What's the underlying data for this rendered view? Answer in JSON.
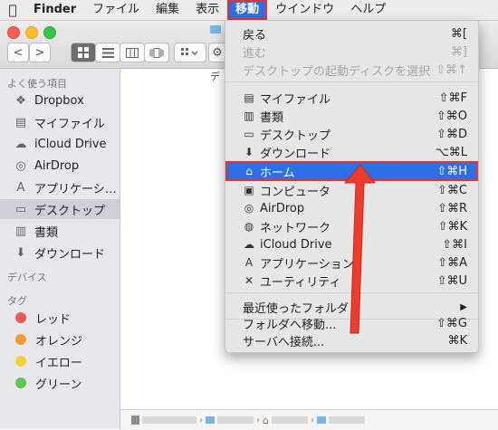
{
  "menubar": {
    "apple_icon": "apple-icon",
    "items": [
      {
        "label": "Finder"
      },
      {
        "label": "ファイル"
      },
      {
        "label": "編集"
      },
      {
        "label": "表示"
      },
      {
        "label": "移動"
      },
      {
        "label": "ウインドウ"
      },
      {
        "label": "ヘルプ"
      }
    ]
  },
  "toolbar": {
    "back": "<",
    "forward": ">",
    "caption": "デ"
  },
  "sidebar": {
    "favorites_header": "よく使う項目",
    "items": [
      {
        "label": "Dropbox",
        "icon": "dropbox-icon"
      },
      {
        "label": "マイファイル",
        "icon": "files-icon"
      },
      {
        "label": "iCloud Drive",
        "icon": "cloud-icon"
      },
      {
        "label": "AirDrop",
        "icon": "airdrop-icon"
      },
      {
        "label": "アプリケーシ…",
        "icon": "applications-icon"
      },
      {
        "label": "デスクトップ",
        "icon": "desktop-icon"
      },
      {
        "label": "書類",
        "icon": "documents-icon"
      },
      {
        "label": "ダウンロード",
        "icon": "download-icon"
      }
    ],
    "devices_header": "デバイス",
    "tags_header": "タグ",
    "tags": [
      {
        "label": "レッド",
        "color": "#f2574e"
      },
      {
        "label": "オレンジ",
        "color": "#f69c33"
      },
      {
        "label": "イエロー",
        "color": "#f5cf33"
      },
      {
        "label": "グリーン",
        "color": "#5cc74f"
      }
    ]
  },
  "go_menu": {
    "items": [
      {
        "label": "戻る",
        "shortcut": "⌘[",
        "enabled": true
      },
      {
        "label": "進む",
        "shortcut": "⌘]",
        "enabled": false
      },
      {
        "label": "デスクトップの起動ディスクを選択",
        "shortcut": "⇧⌘↑",
        "enabled": false
      },
      {
        "label": "マイファイル",
        "shortcut": "⇧⌘F",
        "icon": "files-icon"
      },
      {
        "label": "書類",
        "shortcut": "⇧⌘O",
        "icon": "documents-icon"
      },
      {
        "label": "デスクトップ",
        "shortcut": "⇧⌘D",
        "icon": "desktop-icon"
      },
      {
        "label": "ダウンロード",
        "shortcut": "⌥⌘L",
        "icon": "download-icon"
      },
      {
        "label": "ホーム",
        "shortcut": "⇧⌘H",
        "icon": "home-icon",
        "highlighted": true
      },
      {
        "label": "コンピュータ",
        "shortcut": "⇧⌘C",
        "icon": "computer-icon"
      },
      {
        "label": "AirDrop",
        "shortcut": "⇧⌘R",
        "icon": "airdrop-icon"
      },
      {
        "label": "ネットワーク",
        "shortcut": "⇧⌘K",
        "icon": "network-icon"
      },
      {
        "label": "iCloud Drive",
        "shortcut": "⇧⌘I",
        "icon": "cloud-icon"
      },
      {
        "label": "アプリケーション",
        "shortcut": "⇧⌘A",
        "icon": "applications-icon"
      },
      {
        "label": "ユーティリティ",
        "shortcut": "⇧⌘U",
        "icon": "utilities-icon"
      },
      {
        "label": "最近使ったフォルダ",
        "shortcut": "▶",
        "submenu": true
      },
      {
        "label": "フォルダへ移動...",
        "shortcut": "⇧⌘G"
      },
      {
        "label": "サーバへ接続...",
        "shortcut": "⌘K"
      }
    ]
  },
  "colors": {
    "highlight": "#2d6fe4",
    "annotation_red": "#e8322c"
  }
}
